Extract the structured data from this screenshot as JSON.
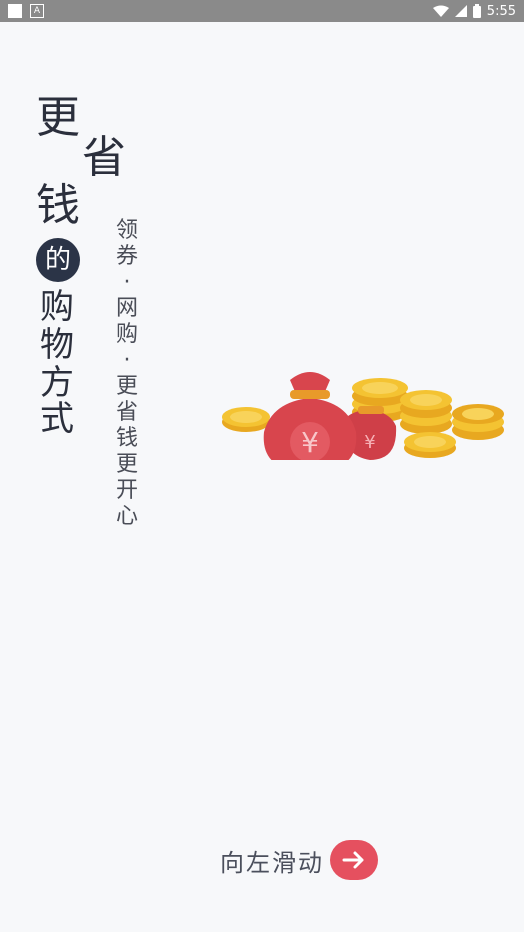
{
  "status_bar": {
    "time": "5:55",
    "left_icons": [
      "app-square-icon",
      "font-a-icon"
    ],
    "right_icons": [
      "wifi-icon",
      "cell-signal-icon",
      "battery-icon"
    ]
  },
  "headline": {
    "chars": [
      "更",
      "省",
      "钱",
      "的",
      "购",
      "物",
      "方",
      "式"
    ]
  },
  "tagline": "领券 · 网购 · 更省钱更开心",
  "illustration": "money-bags-and-coins-icon",
  "swipe": {
    "label": "向左滑动",
    "icon": "arrow-right-icon"
  },
  "colors": {
    "accent": "#e5505f",
    "text_dark": "#2b2f3c",
    "circle_bg": "#2b3447",
    "background": "#f7f8fa",
    "coin": "#f4c332",
    "bag": "#d8454d"
  }
}
